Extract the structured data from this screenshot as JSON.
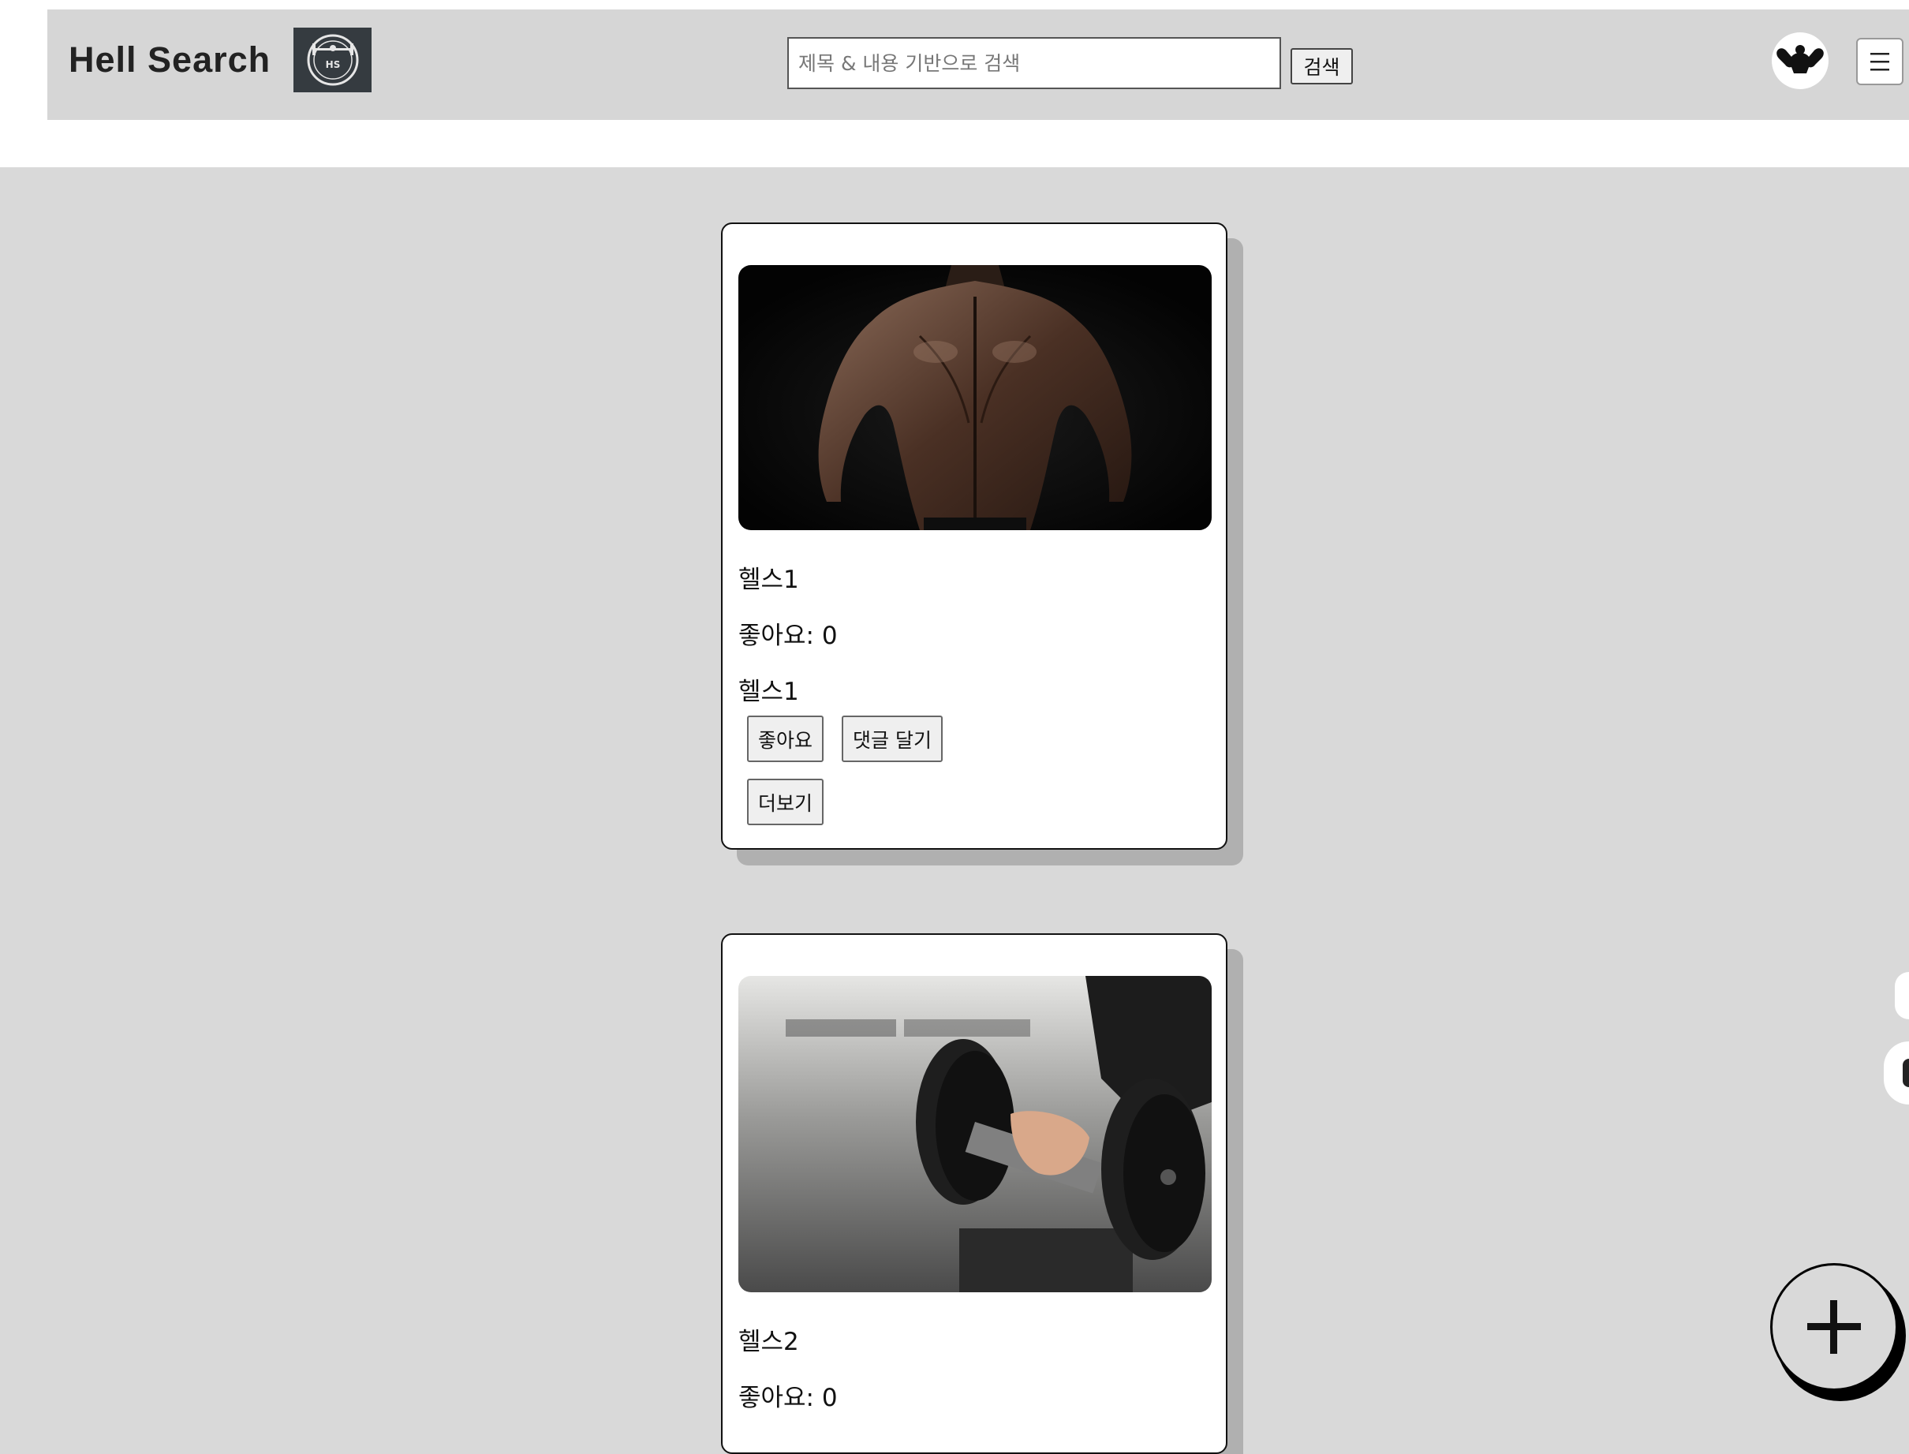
{
  "header": {
    "brand_title": "Hell Search",
    "logo_text": "HS",
    "search": {
      "placeholder": "제목 & 내용 기반으로 검색",
      "value": "",
      "button_label": "검색"
    },
    "avatar_icon": "muscle-icon",
    "menu_icon": "hamburger-icon"
  },
  "posts": [
    {
      "title": "헬스1",
      "likes_text": "좋아요: 0",
      "content": "헬스1",
      "like_label": "좋아요",
      "comment_label": "댓글 달기",
      "more_label": "더보기",
      "image": "bodybuilder-back-photo"
    },
    {
      "title": "헬스2",
      "likes_text": "좋아요: 0",
      "image": "dumbbell-photo"
    }
  ],
  "fab": {
    "icon": "plus-icon"
  },
  "colors": {
    "page_bg": "#d9d9d9",
    "header_bg": "#d6d6d6",
    "card_bg": "#ffffff",
    "card_shadow": "#b0b0b0"
  }
}
